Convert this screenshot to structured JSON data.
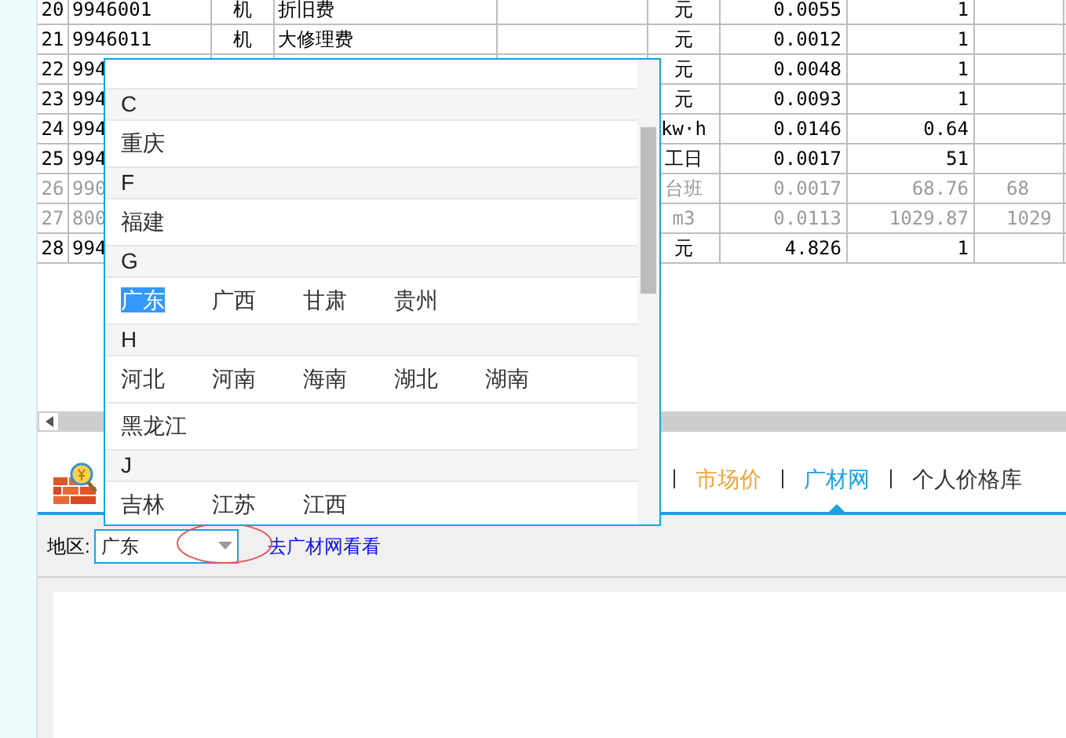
{
  "table": {
    "rows": [
      {
        "index": "20",
        "code": "9946001",
        "type": "机",
        "name": "折旧费",
        "unit": "元",
        "col_7": "0.0055",
        "col_8": "1",
        "disabled": false
      },
      {
        "index": "21",
        "code": "9946011",
        "type": "机",
        "name": "大修理费",
        "unit": "元",
        "col_7": "0.0012",
        "col_8": "1",
        "disabled": false
      },
      {
        "index": "22",
        "code": "994",
        "unit": "元",
        "col_7": "0.0048",
        "col_8": "1",
        "disabled": false
      },
      {
        "index": "23",
        "code": "994",
        "unit": "元",
        "col_7": "0.0093",
        "col_8": "1",
        "disabled": false
      },
      {
        "index": "24",
        "code": "994",
        "unit": "kw·h",
        "col_7": "0.0146",
        "col_8": "0.64",
        "disabled": false
      },
      {
        "index": "25",
        "code": "994",
        "unit": "工日",
        "col_7": "0.0017",
        "col_8": "51",
        "disabled": false
      },
      {
        "index": "26",
        "code": "990",
        "unit": "台班",
        "col_7": "0.0017",
        "col_8": "68.76",
        "col_9": "68",
        "disabled": true
      },
      {
        "index": "27",
        "code": "800",
        "unit": "m3",
        "col_7": "0.0113",
        "col_8": "1029.87",
        "col_9": "1029",
        "disabled": true
      },
      {
        "index": "28",
        "code": "994",
        "unit": "元",
        "col_7": "4.826",
        "col_8": "1",
        "disabled": false
      }
    ]
  },
  "tabs": [
    {
      "label": "市场价",
      "color": "#f5a33c",
      "selected": false
    },
    {
      "label": "广材网",
      "color": "#1ba1e2",
      "selected": true
    },
    {
      "label": "个人价格库",
      "color": "#333333",
      "selected": false
    }
  ],
  "filter": {
    "label": "地区:",
    "value": "广东",
    "link": "去广材网看看"
  },
  "dropdown": {
    "sections": [
      {
        "letter": "C",
        "items": [
          {
            "label": "重庆",
            "selected": false
          }
        ]
      },
      {
        "letter": "F",
        "items": [
          {
            "label": "福建",
            "selected": false
          }
        ]
      },
      {
        "letter": "G",
        "items": [
          {
            "label": "广东",
            "selected": true
          },
          {
            "label": "广西",
            "selected": false
          },
          {
            "label": "甘肃",
            "selected": false
          },
          {
            "label": "贵州",
            "selected": false
          }
        ]
      },
      {
        "letter": "H",
        "items": [
          {
            "label": "河北",
            "selected": false
          },
          {
            "label": "河南",
            "selected": false
          },
          {
            "label": "海南",
            "selected": false
          },
          {
            "label": "湖北",
            "selected": false
          },
          {
            "label": "湖南",
            "selected": false
          },
          {
            "label": "黑龙江",
            "selected": false
          }
        ]
      },
      {
        "letter": "J",
        "items": [
          {
            "label": "吉林",
            "selected": false
          },
          {
            "label": "江苏",
            "selected": false
          },
          {
            "label": "江西",
            "selected": false
          }
        ]
      }
    ]
  }
}
